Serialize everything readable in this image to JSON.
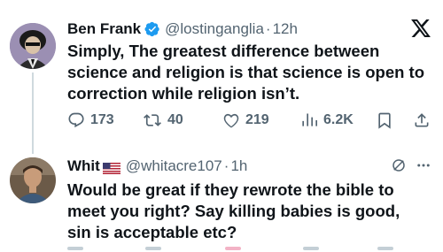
{
  "tweet_main": {
    "name": "Ben Frank",
    "handle": "@lostinganglia",
    "separator": "·",
    "time": "12h",
    "text_lines": [
      "Simply, The greatest difference between",
      "science and religion is that science is open to",
      "correction while religion isn’t."
    ],
    "stats": {
      "replies": "173",
      "reposts": "40",
      "likes": "219",
      "views": "6.2K"
    },
    "icons": [
      "verified-badge-icon",
      "x-logo-icon",
      "reply-icon",
      "repost-icon",
      "like-icon",
      "views-icon",
      "bookmark-icon",
      "share-icon"
    ]
  },
  "tweet_reply": {
    "name": "Whit",
    "handle": "@whitacre107",
    "separator": "·",
    "time": "1h",
    "text_lines": [
      "Would be great if they rewrote the bible to",
      "meet you right?  Say killing babies is good,",
      "sin is acceptable etc?"
    ],
    "icons": [
      "us-flag-icon",
      "grok-icon",
      "more-icon"
    ]
  },
  "colors": {
    "text": "#0f1419",
    "secondary": "#536471",
    "verified": "#1d9bf0",
    "thread_line": "#cfd9de"
  }
}
